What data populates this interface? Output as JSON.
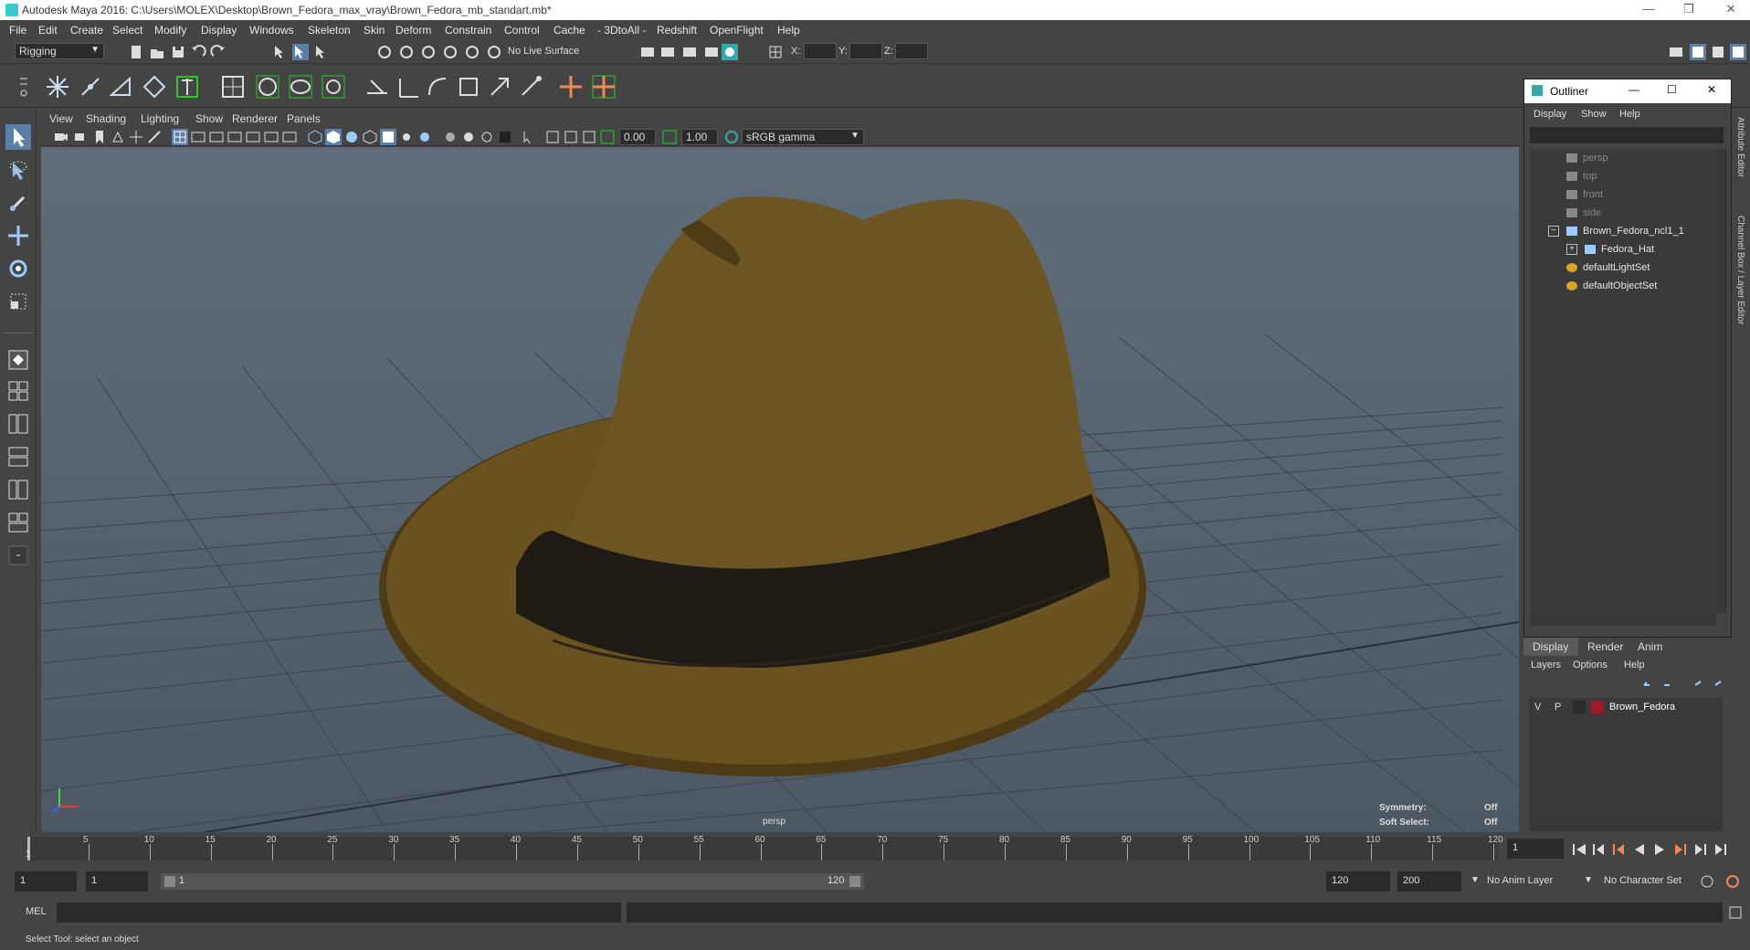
{
  "window": {
    "title": "Autodesk Maya 2016: C:\\Users\\MOLEX\\Desktop\\Brown_Fedora_max_vray\\Brown_Fedora_mb_standart.mb*",
    "controls": [
      "—",
      "❐",
      "✕"
    ]
  },
  "menu": [
    "File",
    "Edit",
    "Create",
    "Select",
    "Modify",
    "Display",
    "Windows",
    "Skeleton",
    "Skin",
    "Deform",
    "Constrain",
    "Control",
    "Cache",
    "- 3DtoAll -",
    "Redshift",
    "OpenFlight",
    "Help"
  ],
  "statusline": {
    "menuset": "Rigging",
    "live_surface": "No Live Surface",
    "x_label": "X:",
    "y_label": "Y:",
    "z_label": "Z:"
  },
  "viewport_menu": [
    "View",
    "Shading",
    "Lighting",
    "Show",
    "Renderer",
    "Panels"
  ],
  "viewport_tools": {
    "exposure": "0.00",
    "gamma": "1.00",
    "colorspace": "sRGB gamma"
  },
  "viewport": {
    "camera_label": "persp",
    "hud": [
      {
        "label": "Symmetry:",
        "value": "Off"
      },
      {
        "label": "Soft Select:",
        "value": "Off"
      }
    ],
    "colors": {
      "hat": "#6a5220",
      "band": "#1e1a14",
      "grid": "#3b4550"
    }
  },
  "outliner": {
    "title": "Outliner",
    "menu": [
      "Display",
      "Show",
      "Help"
    ],
    "items": [
      {
        "label": "persp",
        "dim": true,
        "indent": 0,
        "icon": "camera-icon"
      },
      {
        "label": "top",
        "dim": true,
        "indent": 0,
        "icon": "camera-icon"
      },
      {
        "label": "front",
        "dim": true,
        "indent": 0,
        "icon": "camera-icon"
      },
      {
        "label": "side",
        "dim": true,
        "indent": 0,
        "icon": "camera-icon"
      },
      {
        "label": "Brown_Fedora_ncl1_1",
        "dim": false,
        "indent": 0,
        "icon": "group-icon",
        "expander": "−"
      },
      {
        "label": "Fedora_Hat",
        "dim": false,
        "indent": 1,
        "icon": "mesh-icon",
        "expander": "+"
      },
      {
        "label": "defaultLightSet",
        "dim": false,
        "indent": 0,
        "icon": "set-icon"
      },
      {
        "label": "defaultObjectSet",
        "dim": false,
        "indent": 0,
        "icon": "set-icon"
      }
    ]
  },
  "layers": {
    "tabs": [
      "Display",
      "Render",
      "Anim"
    ],
    "menu": [
      "Layers",
      "Options",
      "Help"
    ],
    "rows": [
      {
        "v": "V",
        "p": "P",
        "name": "Brown_Fedora",
        "color": "#a0182c"
      }
    ]
  },
  "side_tabs": [
    "Attribute Editor",
    "Channel Box / Layer Editor"
  ],
  "timeline": {
    "ticks": [
      "5",
      "10",
      "15",
      "20",
      "25",
      "30",
      "35",
      "40",
      "45",
      "50",
      "55",
      "60",
      "65",
      "70",
      "75",
      "80",
      "85",
      "90",
      "95",
      "100",
      "105",
      "110",
      "115",
      "120"
    ],
    "start_tick": "1",
    "current_frame": "1"
  },
  "range": {
    "start": "1",
    "playback_start": "1",
    "slider_start": "1",
    "slider_end": "120",
    "playback_end": "120",
    "end": "200",
    "anim_layer": "No Anim Layer",
    "char_set": "No Character Set"
  },
  "cmdline": {
    "label": "MEL"
  },
  "helpline": {
    "text": "Select Tool: select an object"
  }
}
